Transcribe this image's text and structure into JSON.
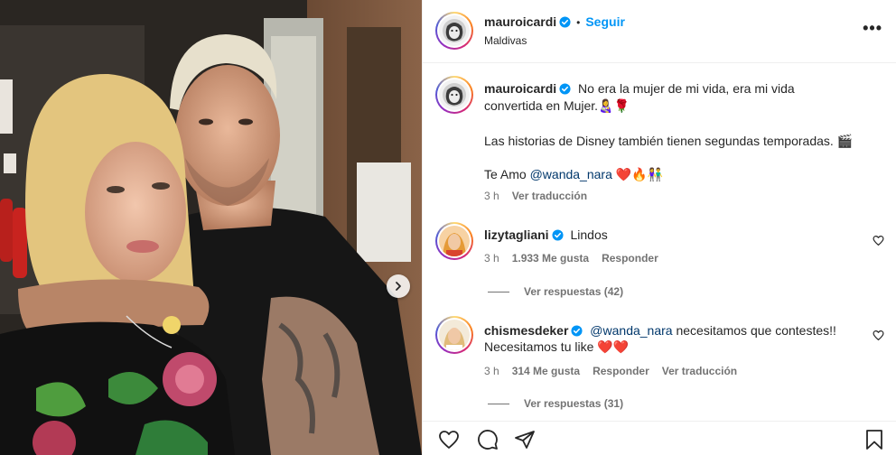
{
  "post": {
    "username": "mauroicardi",
    "follow_label": "Seguir",
    "location": "Maldivas",
    "more_label": "•••"
  },
  "caption": {
    "username": "mauroicardi",
    "line1": "No era la mujer de mi vida, era mi vida",
    "line2": "convertida en Mujer.",
    "line2_emoji": "👩‍🍼🌹",
    "line3": "Las historias de Disney también tienen segundas temporadas.",
    "line3_emoji": "🎬",
    "love_prefix": "Te Amo",
    "mention": "@wanda_nara",
    "love_emoji": "❤️🔥👫",
    "time": "3 h",
    "translate": "Ver traducción"
  },
  "comments": [
    {
      "username": "lizytagliani",
      "text": "Lindos",
      "time": "3 h",
      "likes": "1.933 Me gusta",
      "reply": "Responder",
      "replies": "Ver respuestas (42)"
    },
    {
      "username": "chismesdeker",
      "mention": "@wanda_nara",
      "text": "necesitamos que contestes!!",
      "text2": "Necesitamos tu like",
      "text2_emoji": "❤️❤️",
      "time": "3 h",
      "likes": "314 Me gusta",
      "reply": "Responder",
      "translate": "Ver traducción",
      "replies": "Ver respuestas (31)"
    }
  ],
  "icons": {
    "verified": "verified-badge",
    "like": "heart-icon",
    "comment": "comment-icon",
    "share": "share-icon",
    "save": "bookmark-icon",
    "next": "chevron-right-icon"
  },
  "colors": {
    "accent": "#0095f6",
    "mention": "#00376b",
    "muted": "#737373",
    "heart": "#ed4956"
  }
}
